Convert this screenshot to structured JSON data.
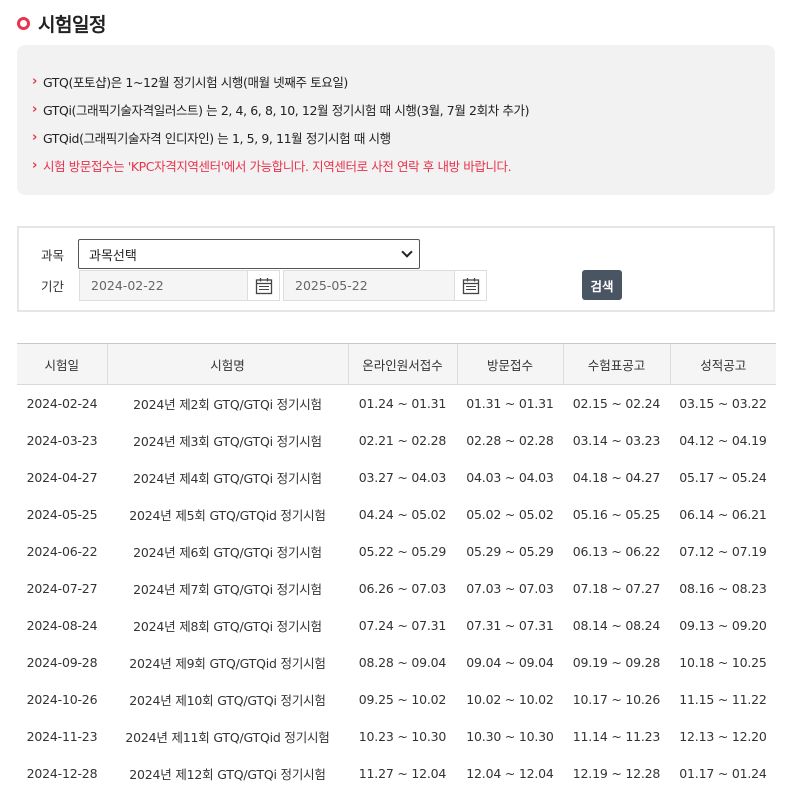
{
  "page": {
    "title": "시험일정",
    "accent_color": "#e8344e"
  },
  "notices": [
    {
      "text": "GTQ(포토샵)은 1~12월 정기시험 시행(매월 넷째주 토요일)",
      "highlight": false
    },
    {
      "text": "GTQi(그래픽기술자격일러스트) 는 2, 4, 6, 8, 10, 12월 정기시험 때 시행(3월, 7월 2회차 추가)",
      "highlight": false
    },
    {
      "text": "GTQid(그래픽기술자격 인디자인) 는 1, 5, 9, 11월 정기시험 때 시행",
      "highlight": false
    },
    {
      "text": "시험 방문접수는 'KPC자격지역센터'에서 가능합니다. 지역센터로 사전 연락 후 내방 바랍니다.",
      "highlight": true
    }
  ],
  "search": {
    "subject_label": "과목",
    "subject_value": "과목선택",
    "period_label": "기간",
    "start_date": "2024-02-22",
    "end_date": "2025-05-22",
    "button_label": "검색",
    "button_color": "#4a5563"
  },
  "table": {
    "headers": [
      "시험일",
      "시험명",
      "온라인원서접수",
      "방문접수",
      "수험표공고",
      "성적공고"
    ],
    "rows": [
      [
        "2024-02-24",
        "2024년 제2회 GTQ/GTQi 정기시험",
        "01.24 ~ 01.31",
        "01.31 ~ 01.31",
        "02.15 ~ 02.24",
        "03.15 ~ 03.22"
      ],
      [
        "2024-03-23",
        "2024년 제3회 GTQ/GTQi 정기시험",
        "02.21 ~ 02.28",
        "02.28 ~ 02.28",
        "03.14 ~ 03.23",
        "04.12 ~ 04.19"
      ],
      [
        "2024-04-27",
        "2024년 제4회 GTQ/GTQi 정기시험",
        "03.27 ~ 04.03",
        "04.03 ~ 04.03",
        "04.18 ~ 04.27",
        "05.17 ~ 05.24"
      ],
      [
        "2024-05-25",
        "2024년 제5회 GTQ/GTQid 정기시험",
        "04.24 ~ 05.02",
        "05.02 ~ 05.02",
        "05.16 ~ 05.25",
        "06.14 ~ 06.21"
      ],
      [
        "2024-06-22",
        "2024년 제6회 GTQ/GTQi 정기시험",
        "05.22 ~ 05.29",
        "05.29 ~ 05.29",
        "06.13 ~ 06.22",
        "07.12 ~ 07.19"
      ],
      [
        "2024-07-27",
        "2024년 제7회 GTQ/GTQi 정기시험",
        "06.26 ~ 07.03",
        "07.03 ~ 07.03",
        "07.18 ~ 07.27",
        "08.16 ~ 08.23"
      ],
      [
        "2024-08-24",
        "2024년 제8회 GTQ/GTQi 정기시험",
        "07.24 ~ 07.31",
        "07.31 ~ 07.31",
        "08.14 ~ 08.24",
        "09.13 ~ 09.20"
      ],
      [
        "2024-09-28",
        "2024년 제9회 GTQ/GTQid 정기시험",
        "08.28 ~ 09.04",
        "09.04 ~ 09.04",
        "09.19 ~ 09.28",
        "10.18 ~ 10.25"
      ],
      [
        "2024-10-26",
        "2024년 제10회 GTQ/GTQi 정기시험",
        "09.25 ~ 10.02",
        "10.02 ~ 10.02",
        "10.17 ~ 10.26",
        "11.15 ~ 11.22"
      ],
      [
        "2024-11-23",
        "2024년 제11회 GTQ/GTQid 정기시험",
        "10.23 ~ 10.30",
        "10.30 ~ 10.30",
        "11.14 ~ 11.23",
        "12.13 ~ 12.20"
      ],
      [
        "2024-12-28",
        "2024년 제12회 GTQ/GTQi 정기시험",
        "11.27 ~ 12.04",
        "12.04 ~ 12.04",
        "12.19 ~ 12.28",
        "01.17 ~ 01.24"
      ]
    ]
  }
}
